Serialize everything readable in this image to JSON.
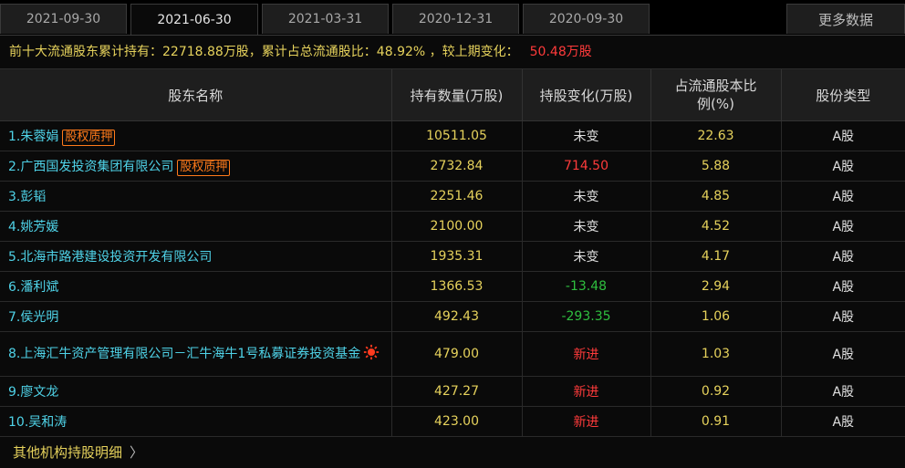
{
  "tabs": [
    "2021-09-30",
    "2021-06-30",
    "2021-03-31",
    "2020-12-31",
    "2020-09-30"
  ],
  "active_tab": "2021-06-30",
  "more_label": "更多数据",
  "summary": {
    "text": "前十大流通股东累计持有：22718.88万股，累计占总流通股比：48.92%  ，较上期变化：",
    "change": "50.48万股"
  },
  "columns": [
    "股东名称",
    "持有数量(万股)",
    "持股变化(万股)",
    "占流通股本比例(%)",
    "股份类型"
  ],
  "rows": [
    {
      "name": "1.朱蓉娟",
      "badge": "股权质押",
      "hold": "10511.05",
      "change": "未变",
      "dir": "same",
      "ratio": "22.63",
      "type": "A股"
    },
    {
      "name": "2.广西国发投资集团有限公司",
      "badge": "股权质押",
      "hold": "2732.84",
      "change": "714.50",
      "dir": "up",
      "ratio": "5.88",
      "type": "A股"
    },
    {
      "name": "3.彭韬",
      "badge": "",
      "hold": "2251.46",
      "change": "未变",
      "dir": "same",
      "ratio": "4.85",
      "type": "A股"
    },
    {
      "name": "4.姚芳媛",
      "badge": "",
      "hold": "2100.00",
      "change": "未变",
      "dir": "same",
      "ratio": "4.52",
      "type": "A股"
    },
    {
      "name": "5.北海市路港建设投资开发有限公司",
      "badge": "",
      "hold": "1935.31",
      "change": "未变",
      "dir": "same",
      "ratio": "4.17",
      "type": "A股"
    },
    {
      "name": "6.潘利斌",
      "badge": "",
      "hold": "1366.53",
      "change": "-13.48",
      "dir": "down",
      "ratio": "2.94",
      "type": "A股"
    },
    {
      "name": "7.侯光明",
      "badge": "",
      "hold": "492.43",
      "change": "-293.35",
      "dir": "down",
      "ratio": "1.06",
      "type": "A股"
    },
    {
      "name": "8.上海汇牛资产管理有限公司－汇牛海牛1号私募证券投资基金",
      "badge": "",
      "hold": "479.00",
      "change": "新进",
      "dir": "up",
      "ratio": "1.03",
      "type": "A股",
      "sun": true
    },
    {
      "name": "9.廖文龙",
      "badge": "",
      "hold": "427.27",
      "change": "新进",
      "dir": "up",
      "ratio": "0.92",
      "type": "A股"
    },
    {
      "name": "10.吴和涛",
      "badge": "",
      "hold": "423.00",
      "change": "新进",
      "dir": "up",
      "ratio": "0.91",
      "type": "A股"
    }
  ],
  "footer": {
    "label": "其他机构持股明细",
    "arrow": "〉"
  },
  "colors": {
    "yellow": "#e6d25c",
    "red": "#ff3b3b",
    "green": "#2fbf3f",
    "cyan": "#4fd3e8",
    "badge": "#ff7a1a"
  }
}
